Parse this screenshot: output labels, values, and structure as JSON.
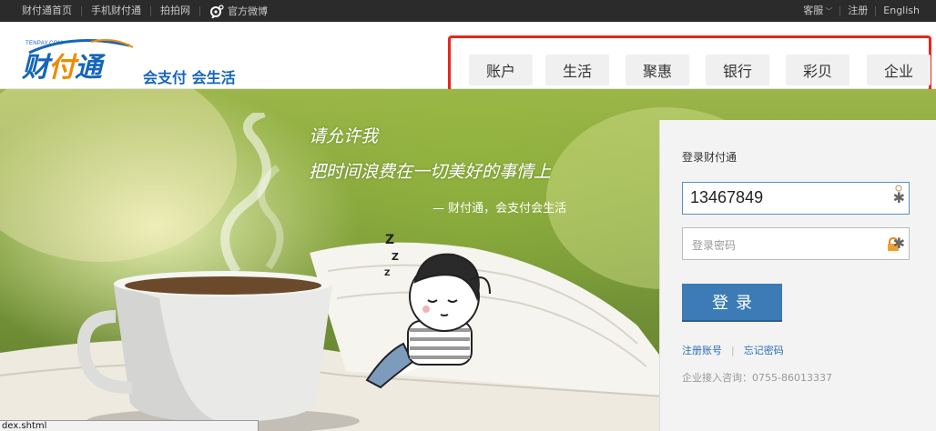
{
  "topbar": {
    "left_links": [
      "财付通首页",
      "手机财付通",
      "拍拍网"
    ],
    "weibo_label": "官方微博",
    "right_links": {
      "service": "客服",
      "register": "注册",
      "language": "English"
    }
  },
  "logo": {
    "small_text": "TENPAY.COM",
    "name_part1": "财",
    "name_part2": "付",
    "name_part3": "通",
    "slogan": "会支付 会生活"
  },
  "nav": {
    "items": [
      {
        "label": "账户"
      },
      {
        "label": "生活"
      },
      {
        "label": "聚惠"
      },
      {
        "label": "银行"
      },
      {
        "label": "彩贝"
      },
      {
        "label": "企业"
      }
    ]
  },
  "hero": {
    "poem_line1": "请允许我",
    "poem_line2": "把时间浪费在一切美好的事情上",
    "tagline": "— 财付通，会支付会生活"
  },
  "login": {
    "title": "登录财付通",
    "account_value": "13467849",
    "password_placeholder": "登录密码",
    "submit_label": "登录",
    "register_link": "注册账号",
    "forgot_link": "忘记密码",
    "contact": "企业接入咨询：0755-86013337"
  },
  "statusbar": {
    "text": "dex.shtml"
  },
  "colors": {
    "brand_blue": "#1565b8",
    "brand_orange": "#f08a00",
    "highlight_red": "#e8261b",
    "button_blue": "#3c7bb5",
    "topbar_bg": "#2b2b2b"
  }
}
